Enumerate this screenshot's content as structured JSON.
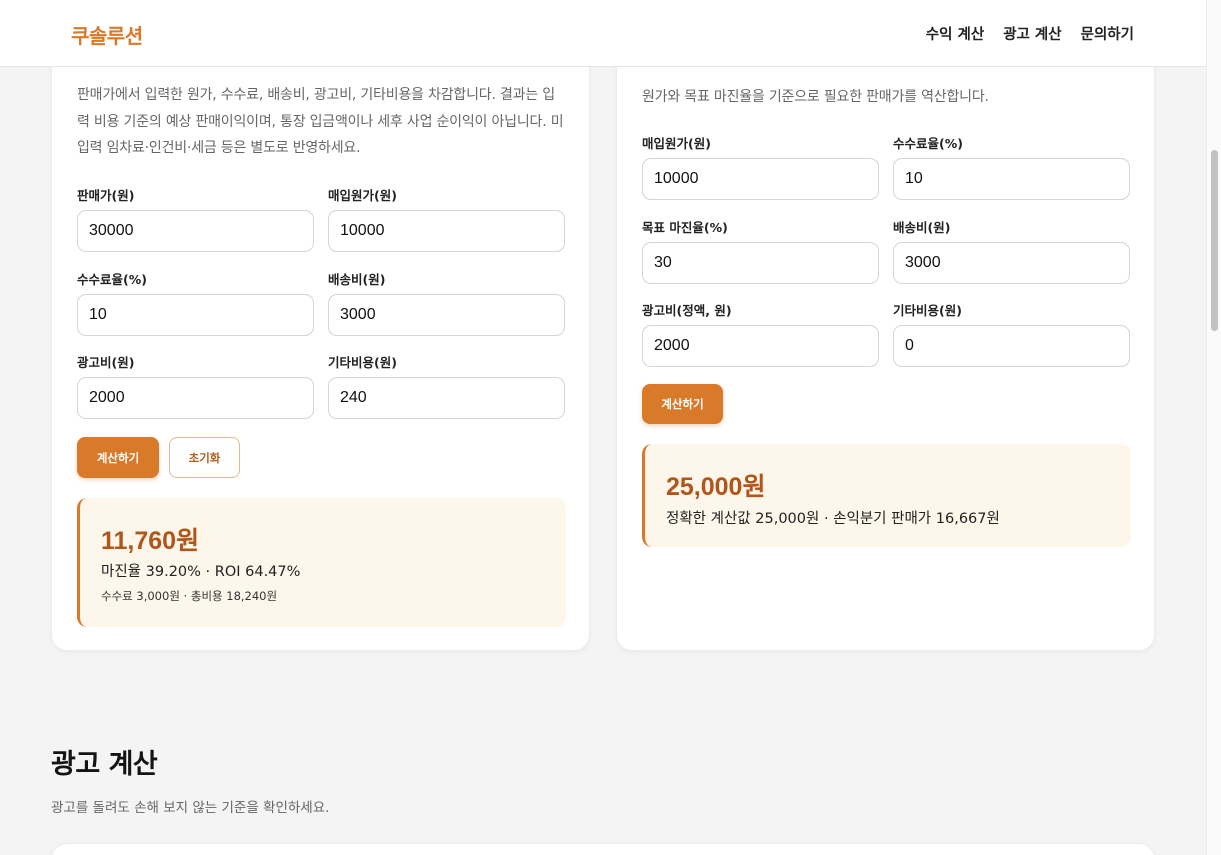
{
  "header": {
    "logo": "쿠솔루션",
    "nav": [
      "수익 계산",
      "광고 계산",
      "문의하기"
    ]
  },
  "profit_calc": {
    "description": "판매가에서 입력한 원가, 수수료, 배송비, 광고비, 기타비용을 차감합니다. 결과는 입력 비용 기준의 예상 판매이익이며, 통장 입금액이나 세후 사업 순이익이 아닙니다. 미입력 임차료·인건비·세금 등은 별도로 반영하세요.",
    "fields": {
      "price": {
        "label": "판매가(원)",
        "value": "30000"
      },
      "cost": {
        "label": "매입원가(원)",
        "value": "10000"
      },
      "fee_rate": {
        "label": "수수료율(%)",
        "value": "10"
      },
      "shipping": {
        "label": "배송비(원)",
        "value": "3000"
      },
      "ad_cost": {
        "label": "광고비(원)",
        "value": "2000"
      },
      "other_cost": {
        "label": "기타비용(원)",
        "value": "240"
      }
    },
    "calc_button": "계산하기",
    "reset_button": "초기화",
    "result": {
      "main": "11,760원",
      "sub": "마진율 39.20% · ROI 64.47%",
      "note": "수수료 3,000원 · 총비용 18,240원"
    }
  },
  "price_calc": {
    "description": "원가와 목표 마진율을 기준으로 필요한 판매가를 역산합니다.",
    "fields": {
      "cost": {
        "label": "매입원가(원)",
        "value": "10000"
      },
      "fee_rate": {
        "label": "수수료율(%)",
        "value": "10"
      },
      "target_margin": {
        "label": "목표 마진율(%)",
        "value": "30"
      },
      "shipping": {
        "label": "배송비(원)",
        "value": "3000"
      },
      "ad_cost": {
        "label": "광고비(정액, 원)",
        "value": "2000"
      },
      "other_cost": {
        "label": "기타비용(원)",
        "value": "0"
      }
    },
    "calc_button": "계산하기",
    "result": {
      "main": "25,000원",
      "sub": "정확한 계산값 25,000원 · 손익분기 판매가 16,667원"
    }
  },
  "ad_section": {
    "title": "광고 계산",
    "description": "광고를 돌려도 손해 보지 않는 기준을 확인하세요."
  },
  "colors": {
    "accent": "#d97a2b",
    "result_bg": "#fdf6ea",
    "result_text": "#b1561a"
  }
}
